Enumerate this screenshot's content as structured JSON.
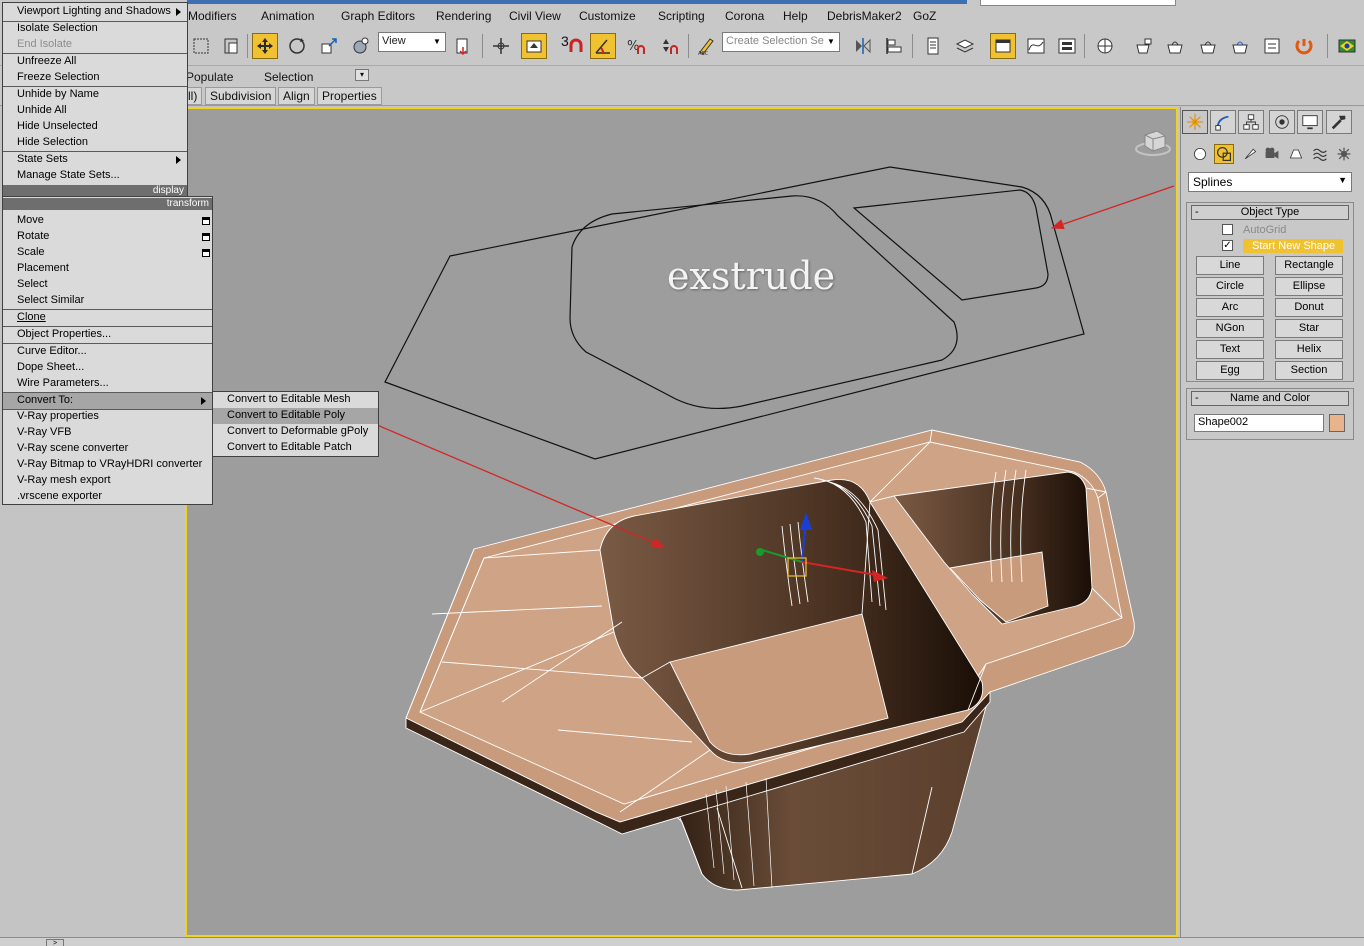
{
  "menubar": {
    "items": [
      "Modifiers",
      "Animation",
      "Graph Editors",
      "Rendering",
      "Civil View",
      "Customize",
      "Scripting",
      "Corona",
      "Help",
      "DebrisMaker2",
      "GoZ"
    ]
  },
  "toolbar": {
    "view_dropdown": "View",
    "selection_set_placeholder": "Create Selection Se",
    "snap_count": "3",
    "icons": [
      "select-region-icon",
      "window-crossing-icon",
      "move-icon",
      "rotate-icon",
      "scale-icon",
      "place-icon",
      "pivot-icon",
      "manipulate-icon",
      "keyboard-shortcut-icon",
      "snap-toggle-icon",
      "angle-snap-icon",
      "percent-snap-icon",
      "spinner-snap-icon",
      "edit-named-selection-icon",
      "mirror-icon",
      "align-icon",
      "scene-explorer-icon",
      "layer-icon",
      "ribbon-toggle-icon",
      "curve-editor-icon",
      "schematic-view-icon",
      "material-editor-icon",
      "render-setup-icon",
      "rendered-frame-icon",
      "render-icon",
      "render-iterative-icon",
      "render-cloud-icon",
      "frame-buffer-icon",
      "corona-icon",
      "vray-icon"
    ]
  },
  "ribbon": {
    "row1": [
      "Populate",
      "Selection"
    ],
    "tabs": [
      "ll)",
      "Subdivision",
      "Align",
      "Properties"
    ]
  },
  "viewport": {
    "label": "exstrude",
    "colors": {
      "background": "#9d9d9d",
      "border": "#f2d21c",
      "surface": "#cfa385",
      "shadow": "#3a2618",
      "wire": "#ffffff",
      "arrow": "#d42424"
    }
  },
  "quadmenu": {
    "display": {
      "header": "display",
      "items": [
        {
          "label": "Viewport Lighting and Shadows",
          "submenu": true
        },
        {
          "label": "Isolate Selection"
        },
        {
          "label": "End Isolate",
          "dim": true
        },
        {
          "label": "Unfreeze All"
        },
        {
          "label": "Freeze Selection"
        },
        {
          "label": "Unhide by Name"
        },
        {
          "label": "Unhide All"
        },
        {
          "label": "Hide Unselected"
        },
        {
          "label": "Hide Selection"
        },
        {
          "label": "State Sets",
          "submenu": true
        },
        {
          "label": "Manage State Sets..."
        }
      ]
    },
    "transform": {
      "header": "transform",
      "items": [
        {
          "label": "Move",
          "options": true
        },
        {
          "label": "Rotate",
          "options": true
        },
        {
          "label": "Scale",
          "options": true
        },
        {
          "label": "Placement"
        },
        {
          "label": "Select"
        },
        {
          "label": "Select Similar"
        },
        {
          "label": "Clone"
        },
        {
          "label": "Object Properties..."
        },
        {
          "label": "Curve Editor..."
        },
        {
          "label": "Dope Sheet..."
        },
        {
          "label": "Wire Parameters..."
        },
        {
          "label": "Convert To:",
          "submenu": true,
          "highlighted": true
        },
        {
          "label": "V-Ray properties"
        },
        {
          "label": "V-Ray VFB"
        },
        {
          "label": "V-Ray scene converter"
        },
        {
          "label": "V-Ray Bitmap to VRayHDRI converter"
        },
        {
          "label": "V-Ray mesh export"
        },
        {
          "label": ".vrscene exporter"
        }
      ]
    },
    "convert_submenu": {
      "items": [
        {
          "label": "Convert to Editable Mesh"
        },
        {
          "label": "Convert to Editable Poly",
          "highlighted": true
        },
        {
          "label": "Convert to Deformable gPoly"
        },
        {
          "label": "Convert to Editable Patch"
        }
      ]
    }
  },
  "command_panel": {
    "tabs": [
      "create-tab-icon",
      "modify-tab-icon",
      "hierarchy-tab-icon",
      "motion-tab-icon",
      "display-tab-icon",
      "utilities-tab-icon"
    ],
    "categories": [
      "geometry-icon",
      "shapes-icon",
      "lights-icon",
      "cameras-icon",
      "helpers-icon",
      "space-warps-icon",
      "systems-icon"
    ],
    "subcategory": "Splines",
    "object_type": {
      "title": "Object Type",
      "autogrid": "AutoGrid",
      "start_new_shape": "Start New Shape",
      "buttons": [
        "Line",
        "Rectangle",
        "Circle",
        "Ellipse",
        "Arc",
        "Donut",
        "NGon",
        "Star",
        "Text",
        "Helix",
        "Egg",
        "Section"
      ]
    },
    "name_and_color": {
      "title": "Name and Color",
      "name": "Shape002",
      "color": "#e8b48e"
    }
  },
  "statusbar": {
    "arrow": ">"
  }
}
